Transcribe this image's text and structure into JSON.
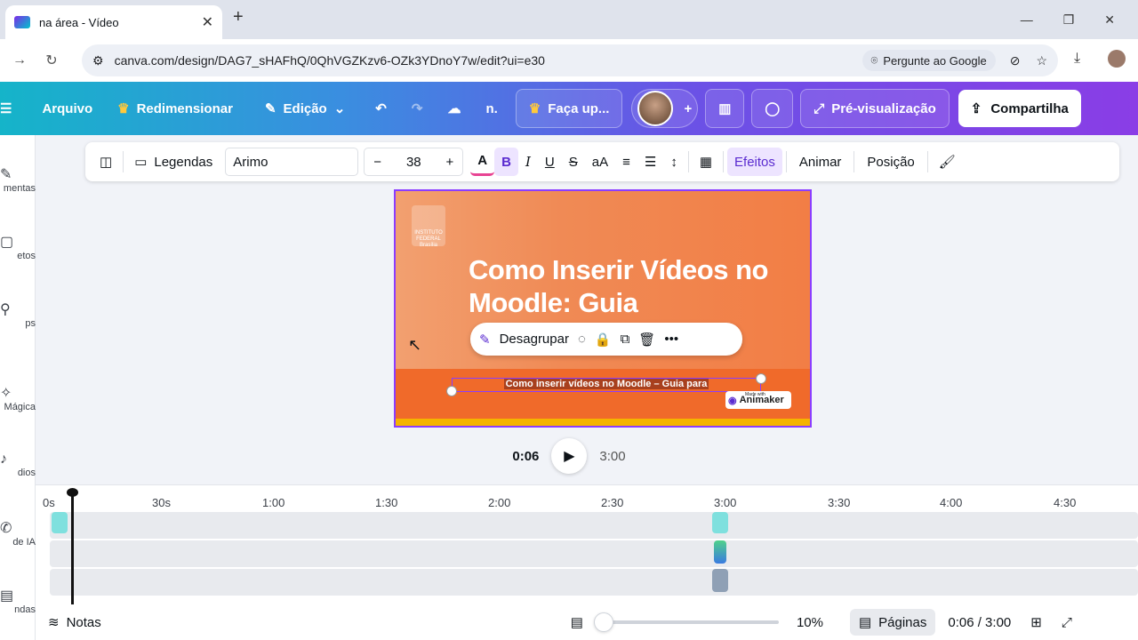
{
  "browser": {
    "tab_title": "na área - Vídeo",
    "tab_close": "✕",
    "new_tab": "+",
    "url": "canva.com/design/DAG7_sHAFhQ/0QhVGZKzv6-OZk3YDnoY7w/edit?ui=e30",
    "ask_google": "Pergunte ao Google"
  },
  "header": {
    "arquivo": "Arquivo",
    "redimensionar": "Redimensionar",
    "edicao": "Edição",
    "title_short": "n.",
    "upgrade": "Faça up...",
    "preview": "Pré-visualização",
    "share": "Compartilha"
  },
  "sidebar": {
    "items": [
      {
        "label": "mentas",
        "icon": "✎"
      },
      {
        "label": "etos",
        "icon": "▢"
      },
      {
        "label": "ps",
        "icon": "⚲"
      },
      {
        "label": "Mágica",
        "icon": "✧"
      },
      {
        "label": "dios",
        "icon": "♪"
      },
      {
        "label": "de IA",
        "icon": "✆"
      },
      {
        "label": "ndas",
        "icon": "▤"
      }
    ]
  },
  "toolbar": {
    "legendas": "Legendas",
    "font": "Arimo",
    "minus": "−",
    "size": "38",
    "plus": "+",
    "bold": "B",
    "italic": "I",
    "underline": "U",
    "strike": "S",
    "case": "aA",
    "efeitos": "Efeitos",
    "animar": "Animar",
    "posicao": "Posição"
  },
  "slide": {
    "logo_text": "INSTITUTO FEDERAL Brasília",
    "title": "Como Inserir Vídeos no Moodle: Guia",
    "subtitle": "Como inserir vídeos no Moodle – Guia para",
    "animaker_small": "Made with",
    "animaker": "Animaker"
  },
  "context_menu": {
    "desagrupar": "Desagrupar"
  },
  "playback": {
    "current": "0:06",
    "total": "3:00"
  },
  "timeline": {
    "ticks": [
      "0s",
      "30s",
      "1:00",
      "1:30",
      "2:00",
      "2:30",
      "3:00",
      "3:30",
      "4:00",
      "4:30"
    ]
  },
  "footer": {
    "notas": "Notas",
    "zoom": "10%",
    "paginas": "Páginas",
    "time": "0:06 / 3:00"
  },
  "colors": {
    "accent": "#8b3dff",
    "slide_orange": "#f27e45",
    "subtitle_border": "#8b3dff"
  }
}
